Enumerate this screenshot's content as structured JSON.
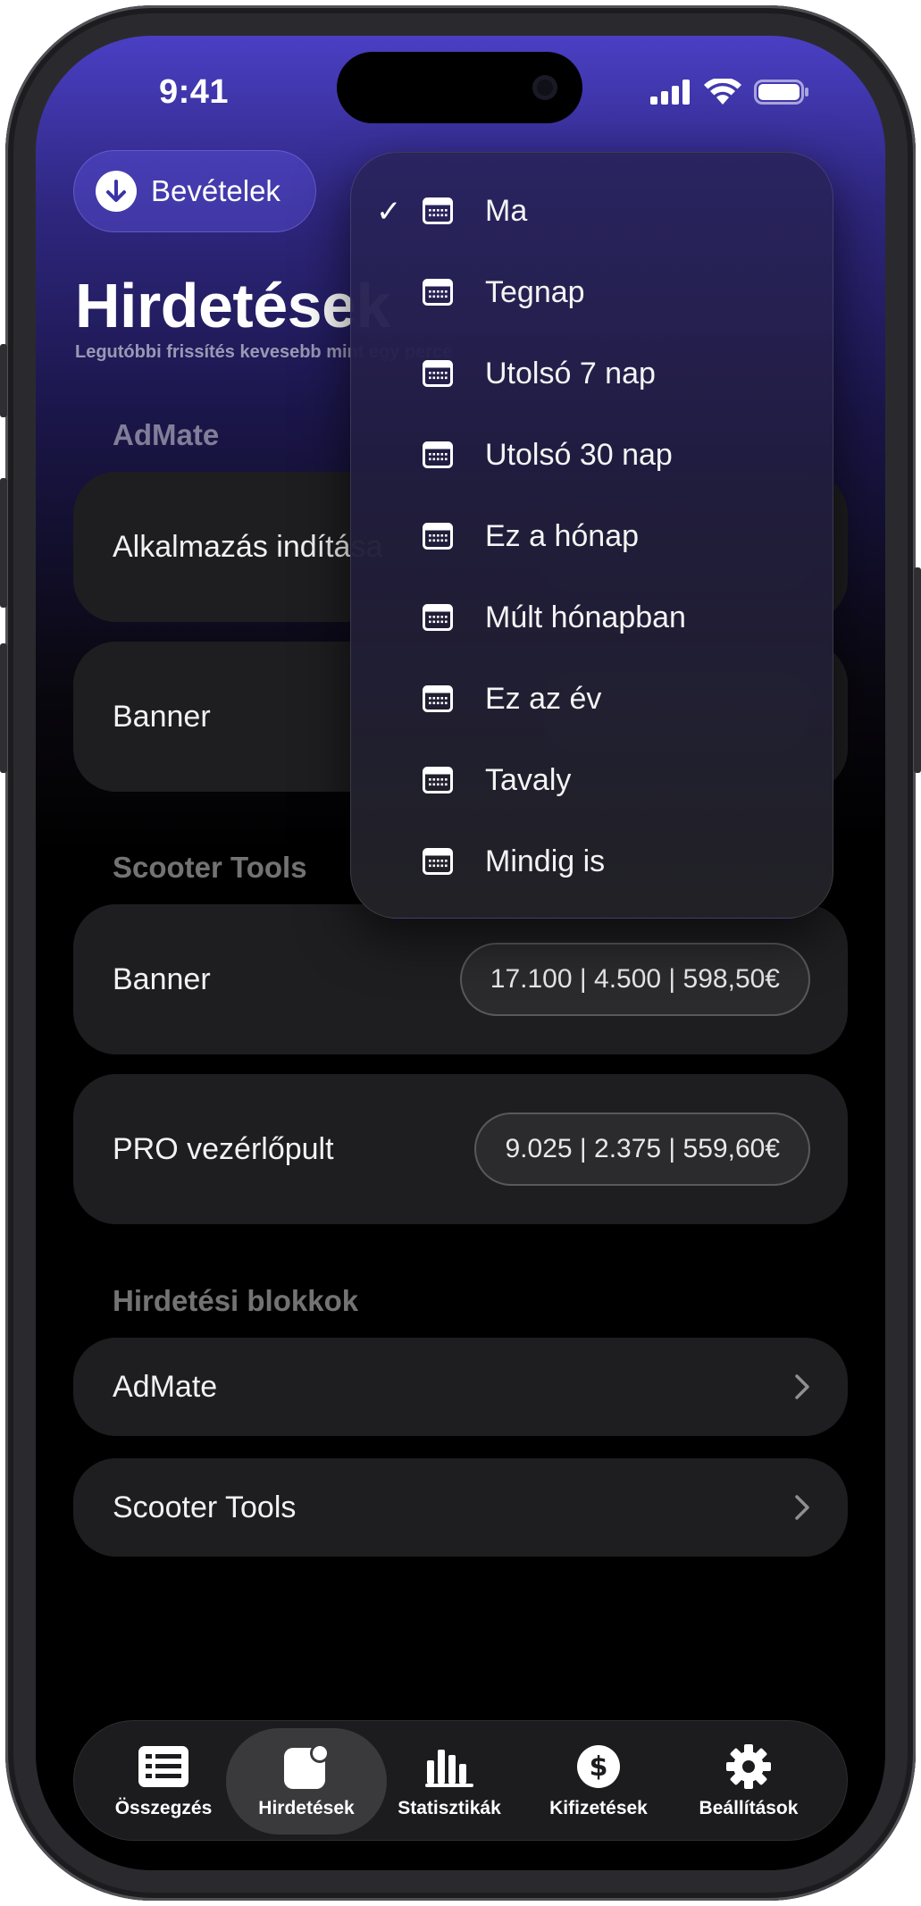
{
  "status_bar": {
    "time": "9:41"
  },
  "header": {
    "revenue_button_label": "Bevételek",
    "title": "Hirdetések",
    "subtitle": "Legutóbbi frissítés kevesebb mint egy perce"
  },
  "sections": [
    {
      "title": "AdMate",
      "items": [
        {
          "name": "Alkalmazás indítása",
          "stats": ""
        },
        {
          "name": "Banner",
          "stats": ""
        }
      ]
    },
    {
      "title": "Scooter Tools",
      "items": [
        {
          "name": "Banner",
          "stats": "17.100 | 4.500 | 598,50€"
        },
        {
          "name": "PRO vezérlőpult",
          "stats": "9.025 | 2.375 | 559,60€"
        }
      ]
    }
  ],
  "ad_blocks": {
    "title": "Hirdetési blokkok",
    "items": [
      {
        "label": "AdMate"
      },
      {
        "label": "Scooter Tools"
      }
    ]
  },
  "date_range_menu": {
    "selected_index": 0,
    "options": [
      "Ma",
      "Tegnap",
      "Utolsó 7 nap",
      "Utolsó 30 nap",
      "Ez a hónap",
      "Múlt hónapban",
      "Ez az év",
      "Tavaly",
      "Mindig is"
    ],
    "icon": "calendar-icon",
    "check_icon": "checkmark-icon"
  },
  "tab_bar": {
    "active_index": 1,
    "tabs": [
      {
        "label": "Összegzés",
        "icon": "list-icon"
      },
      {
        "label": "Hirdetések",
        "icon": "ad-badge-icon"
      },
      {
        "label": "Statisztikák",
        "icon": "bar-chart-icon"
      },
      {
        "label": "Kifizetések",
        "icon": "dollar-icon"
      },
      {
        "label": "Beállítások",
        "icon": "gear-icon"
      }
    ]
  },
  "colors": {
    "accent": "#4a3fc4",
    "card": "#1e1e20",
    "background": "#000000"
  }
}
